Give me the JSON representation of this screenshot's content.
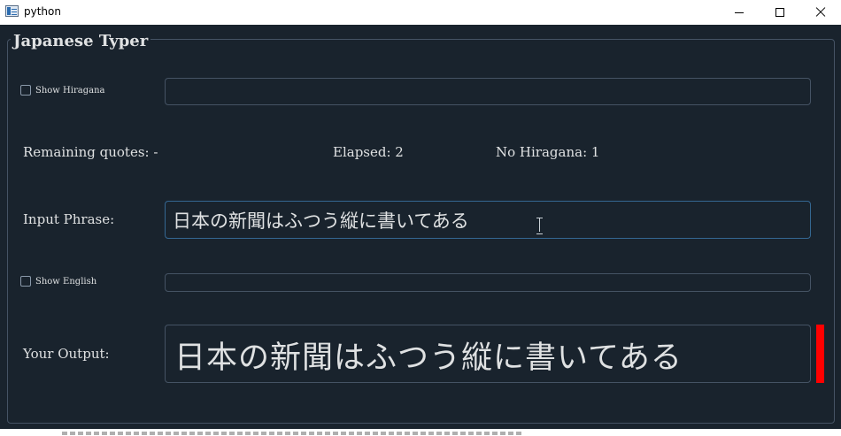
{
  "window": {
    "title": "python"
  },
  "group": {
    "title": "Japanese Typer"
  },
  "hiragana": {
    "checkbox_label": "Show Hiragana",
    "checked": false,
    "value": ""
  },
  "stats": {
    "remaining": "Remaining quotes: -",
    "elapsed": "Elapsed: 2",
    "no_hiragana": "No Hiragana: 1"
  },
  "input_phrase": {
    "label": "Input Phrase:",
    "value": "日本の新聞はふつう縦に書いてある"
  },
  "english": {
    "checkbox_label": "Show English",
    "checked": false,
    "value": ""
  },
  "output": {
    "label": "Your Output:",
    "value": "日本の新聞はふつう縦に書いてある",
    "indicator_color": "#ff0000"
  },
  "colors": {
    "background": "#19232d",
    "border": "#455364",
    "focus_border": "#346792",
    "text": "#dfe1e2"
  }
}
